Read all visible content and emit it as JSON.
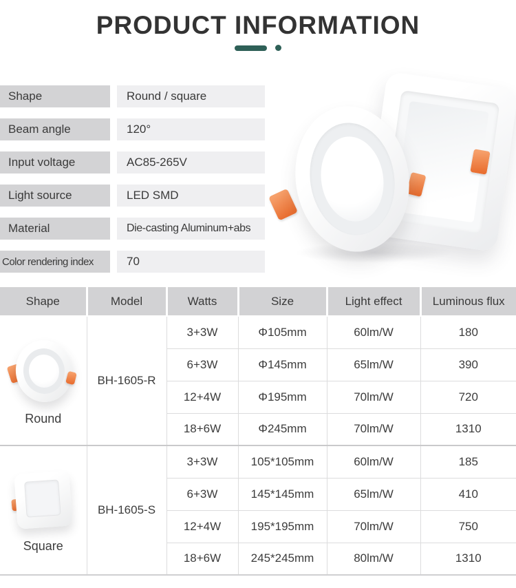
{
  "title": "PRODUCT INFORMATION",
  "colors": {
    "accent_teal": "#2e6057",
    "header_bg": "#d2d2d4",
    "label_bg": "#d3d3d5",
    "value_bg": "#efeff1",
    "text": "#3b3b3b",
    "clip_orange": "#ec7436"
  },
  "specs": [
    {
      "label": "Shape",
      "value": "Round / square"
    },
    {
      "label": "Beam angle",
      "value": "120°"
    },
    {
      "label": "Input voltage",
      "value": "AC85-265V"
    },
    {
      "label": "Light source",
      "value": "LED SMD"
    },
    {
      "label": "Material",
      "value": "Die-casting Aluminum+abs"
    },
    {
      "label": "Color rendering index",
      "value": "70"
    }
  ],
  "table": {
    "headers": [
      "Shape",
      "Model",
      "Watts",
      "Size",
      "Light effect",
      "Luminous flux"
    ],
    "groups": [
      {
        "shape": "Round",
        "model": "BH-1605-R",
        "rows": [
          {
            "watts": "3+3W",
            "size": "Φ105mm",
            "light_effect": "60lm/W",
            "luminous_flux": "180"
          },
          {
            "watts": "6+3W",
            "size": "Φ145mm",
            "light_effect": "65lm/W",
            "luminous_flux": "390"
          },
          {
            "watts": "12+4W",
            "size": "Φ195mm",
            "light_effect": "70lm/W",
            "luminous_flux": "720"
          },
          {
            "watts": "18+6W",
            "size": "Φ245mm",
            "light_effect": "70lm/W",
            "luminous_flux": "1310"
          }
        ]
      },
      {
        "shape": "Square",
        "model": "BH-1605-S",
        "rows": [
          {
            "watts": "3+3W",
            "size": "105*105mm",
            "light_effect": "60lm/W",
            "luminous_flux": "185"
          },
          {
            "watts": "6+3W",
            "size": "145*145mm",
            "light_effect": "65lm/W",
            "luminous_flux": "410"
          },
          {
            "watts": "12+4W",
            "size": "195*195mm",
            "light_effect": "70lm/W",
            "luminous_flux": "750"
          },
          {
            "watts": "18+6W",
            "size": "245*245mm",
            "light_effect": "80lm/W",
            "luminous_flux": "1310"
          }
        ]
      }
    ]
  }
}
